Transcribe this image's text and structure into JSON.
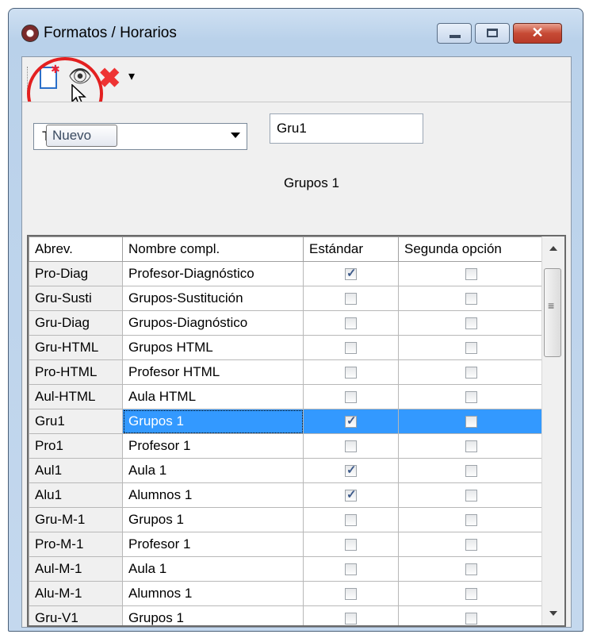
{
  "window": {
    "title": "Formatos / Horarios",
    "controls": {
      "minimize": "minimize",
      "maximize": "maximize",
      "close": "✕"
    }
  },
  "toolbar": {
    "icons": [
      "new-document-icon",
      "eye-icon",
      "delete-x-icon",
      "dropdown-arrow-icon"
    ],
    "tooltip": "Nuevo",
    "highlight_color": "#e32020"
  },
  "form": {
    "type_combo_value": "T",
    "code_value": "Gru1",
    "full_name_caption": "Grupos 1"
  },
  "table": {
    "headers": [
      "Abrev.",
      "Nombre compl.",
      "Estándar",
      "Segunda opción"
    ],
    "rows": [
      {
        "abbr": "Pro-Diag",
        "name": "Profesor-Diagnóstico",
        "standard": true,
        "second": false
      },
      {
        "abbr": "Gru-Susti",
        "name": "Grupos-Sustitución",
        "standard": false,
        "second": false
      },
      {
        "abbr": "Gru-Diag",
        "name": "Grupos-Diagnóstico",
        "standard": false,
        "second": false
      },
      {
        "abbr": "Gru-HTML",
        "name": "Grupos HTML",
        "standard": false,
        "second": false
      },
      {
        "abbr": "Pro-HTML",
        "name": "Profesor HTML",
        "standard": false,
        "second": false
      },
      {
        "abbr": "Aul-HTML",
        "name": "Aula HTML",
        "standard": false,
        "second": false
      },
      {
        "abbr": "Gru1",
        "name": "Grupos 1",
        "standard": true,
        "second": false,
        "selected": true
      },
      {
        "abbr": "Pro1",
        "name": "Profesor 1",
        "standard": false,
        "second": false
      },
      {
        "abbr": "Aul1",
        "name": "Aula 1",
        "standard": true,
        "second": false
      },
      {
        "abbr": "Alu1",
        "name": "Alumnos 1",
        "standard": true,
        "second": false
      },
      {
        "abbr": "Gru-M-1",
        "name": "Grupos 1",
        "standard": false,
        "second": false
      },
      {
        "abbr": "Pro-M-1",
        "name": "Profesor 1",
        "standard": false,
        "second": false
      },
      {
        "abbr": "Aul-M-1",
        "name": "Aula 1",
        "standard": false,
        "second": false
      },
      {
        "abbr": "Alu-M-1",
        "name": "Alumnos 1",
        "standard": false,
        "second": false
      },
      {
        "abbr": "Gru-V1",
        "name": "Grupos 1",
        "standard": false,
        "second": false
      }
    ],
    "selection_color": "#3399ff"
  }
}
